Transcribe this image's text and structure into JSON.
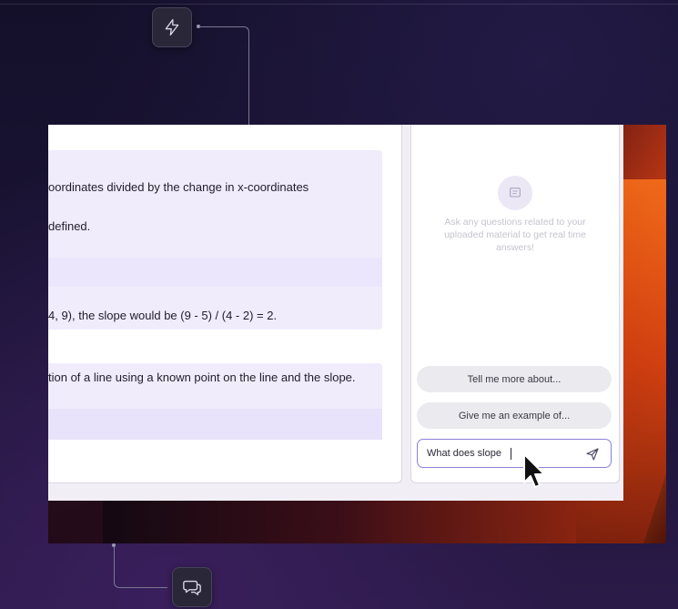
{
  "document": {
    "block1_line1": "oordinates divided by the change in x-coordinates",
    "block1_line2": "defined.",
    "block2_line1": "4, 9), the slope would be (9 - 5) / (4 - 2) = 2.",
    "block3_line1": "tion of a line using a known point on the line and the slope."
  },
  "chat": {
    "empty_hint": "Ask any questions related to your uploaded material to get real time answers!",
    "suggestions": [
      "Tell me more about...",
      "Give me an example of..."
    ],
    "input_value": "What does slope"
  },
  "icons": {
    "top_float": "lightning-icon",
    "bottom_float": "chat-bubbles-icon",
    "empty_state": "message-icon",
    "send": "send-icon"
  },
  "colors": {
    "accent": "#8d7fd6",
    "highlight_block": "#f0ecfc"
  }
}
